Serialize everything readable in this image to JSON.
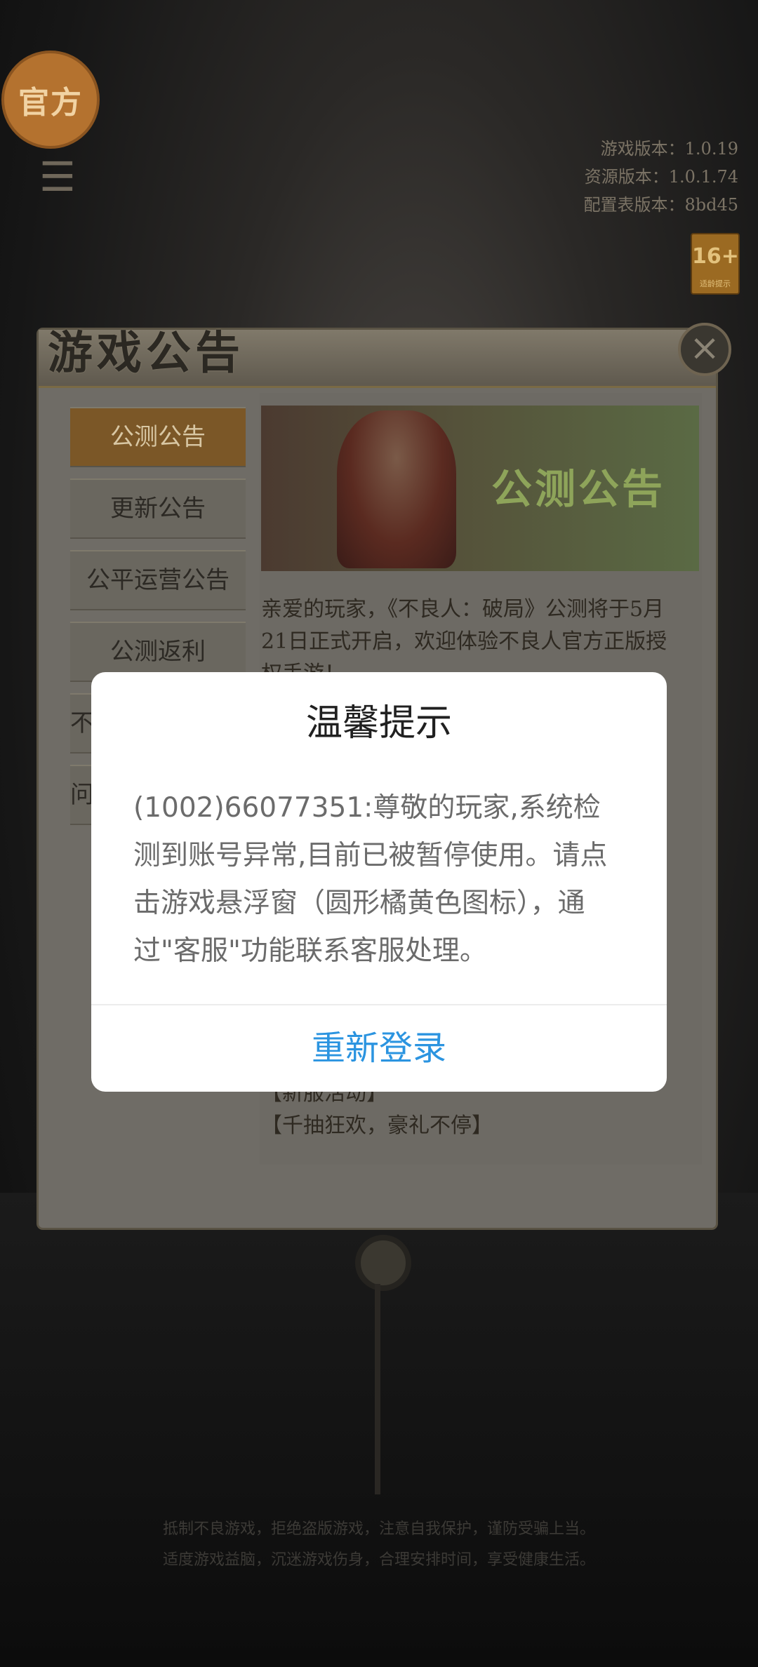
{
  "background": {
    "official_badge": "官方",
    "version": {
      "game": "游戏版本：1.0.19",
      "resource": "资源版本：1.0.1.74",
      "config": "配置表版本：8bd45"
    },
    "age_rating": "16+",
    "age_rating_sub": "适龄提示",
    "footer": [
      "抵制不良游戏，拒绝盗版游戏，注意自我保护，谨防受骗上当。",
      "适度游戏益脑，沉迷游戏伤身，合理安排时间，享受健康生活。"
    ]
  },
  "announcement_panel": {
    "title": "游戏公告",
    "close_icon": "close-icon",
    "tabs": [
      {
        "label": "公测公告",
        "active": true
      },
      {
        "label": "更新公告",
        "active": false
      },
      {
        "label": "公平运营公告",
        "active": false
      },
      {
        "label": "公测返利",
        "active": false
      },
      {
        "label": "不",
        "active": false
      },
      {
        "label": "问",
        "active": false
      }
    ],
    "banner_text": "公测公告",
    "content_lines": [
      "亲爱的玩家，《不良人：破局》公测将于5月",
      "21日正式开启，欢迎体验不良人官方正版授",
      "权手游！"
    ],
    "event_lines": [
      "【新服活动】",
      "【千抽狂欢，豪礼不停】"
    ]
  },
  "dialog": {
    "title": "温馨提示",
    "message": "(1002)66077351:尊敬的玩家,系统检测到账号异常,目前已被暂停使用。请点击游戏悬浮窗（圆形橘黄色图标），通过\"客服\"功能联系客服处理。",
    "button": "重新登录",
    "button_color": "#2B94E0"
  }
}
